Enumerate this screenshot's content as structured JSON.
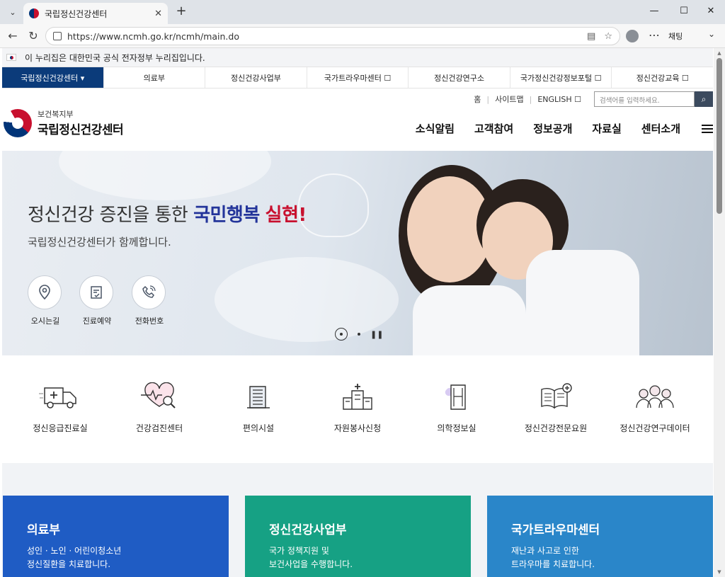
{
  "browser": {
    "tab_title": "국립정신건강센터",
    "url": "https://www.ncmh.go.kr/ncmh/main.do",
    "copilot_label": "채팅"
  },
  "gov_banner": "이 누리집은 대한민국 공식 전자정부 누리집입니다.",
  "top_nav": [
    {
      "label": "국립정신건강센터 ▾",
      "active": true
    },
    {
      "label": "의료부"
    },
    {
      "label": "정신건강사업부"
    },
    {
      "label": "국가트라우마센터 ☐"
    },
    {
      "label": "정신건강연구소"
    },
    {
      "label": "국가정신건강정보포털 ☐"
    },
    {
      "label": "정신건강교육 ☐"
    }
  ],
  "util": {
    "home": "홈",
    "sitemap": "사이트맵",
    "english": "ENGLISH ☐",
    "search_placeholder": "검색어를 입력하세요."
  },
  "logo": {
    "ministry": "보건복지부",
    "center": "국립정신건강센터"
  },
  "gnb": [
    "소식알림",
    "고객참여",
    "정보공개",
    "자료실",
    "센터소개"
  ],
  "hero": {
    "title_plain": "정신건강 증진을 통한 ",
    "title_blue": "국민행복",
    "title_red": "실현!",
    "subtitle": "국립정신건강센터가 함께합니다.",
    "quick_links": [
      {
        "label": "오시는길",
        "icon": "location-pin-icon"
      },
      {
        "label": "진료예약",
        "icon": "reservation-icon"
      },
      {
        "label": "전화번호",
        "icon": "phone-icon"
      }
    ]
  },
  "services": [
    {
      "label": "정신응급진료실",
      "icon": "ambulance-icon"
    },
    {
      "label": "건강검진센터",
      "icon": "heart-check-icon"
    },
    {
      "label": "편의시설",
      "icon": "building-icon"
    },
    {
      "label": "자원봉사신청",
      "icon": "hospital-icon"
    },
    {
      "label": "의학정보실",
      "icon": "medical-info-icon"
    },
    {
      "label": "정신건강전문요원",
      "icon": "book-plus-icon"
    },
    {
      "label": "정신건강연구데이터",
      "icon": "people-icon"
    }
  ],
  "cards": [
    {
      "title": "의료부",
      "desc": "성인 · 노인 · 어린이청소년\n정신질환을 치료합니다.",
      "color": "#1f5cc4"
    },
    {
      "title": "정신건강사업부",
      "desc": "국가 정책지원 및\n보건사업을 수행합니다.",
      "color": "#16a184"
    },
    {
      "title": "국가트라우마센터",
      "desc": "재난과 사고로 인한\n트라우마를 치료합니다.",
      "color": "#2a86c9"
    }
  ]
}
